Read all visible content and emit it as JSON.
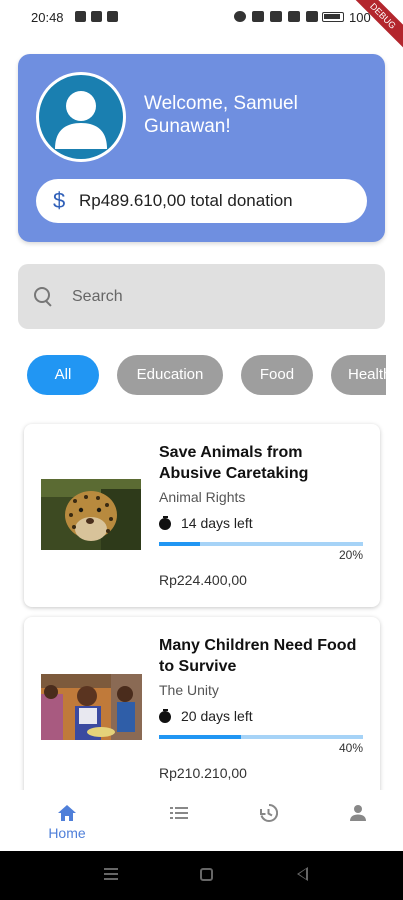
{
  "status_bar": {
    "time": "20:48",
    "battery": "100",
    "debug_banner": "DEBUG"
  },
  "header": {
    "welcome": "Welcome, Samuel Gunawan!",
    "donation_total": "Rp489.610,00 total donation",
    "currency_icon": "$"
  },
  "search": {
    "placeholder": "Search"
  },
  "categories": [
    {
      "label": "All",
      "active": true
    },
    {
      "label": "Education",
      "active": false
    },
    {
      "label": "Food",
      "active": false
    },
    {
      "label": "Health",
      "active": false
    }
  ],
  "campaigns": [
    {
      "title": "Save Animals from Abusive Caretaking",
      "organization": "Animal Rights",
      "days_left": "14 days left",
      "progress_percent": 20,
      "progress_label": "20%",
      "amount": "Rp224.400,00"
    },
    {
      "title": "Many Children Need Food to Survive",
      "organization": "The Unity",
      "days_left": "20 days left",
      "progress_percent": 40,
      "progress_label": "40%",
      "amount": "Rp210.210,00"
    }
  ],
  "bottom_nav": {
    "home_label": "Home",
    "items": [
      "home-icon",
      "list-icon",
      "history-icon",
      "person-icon"
    ]
  },
  "colors": {
    "header_bg": "#6f8fe0",
    "accent": "#2196f3",
    "chip_inactive": "#9e9e9e",
    "nav_active": "#4f7fd9"
  }
}
